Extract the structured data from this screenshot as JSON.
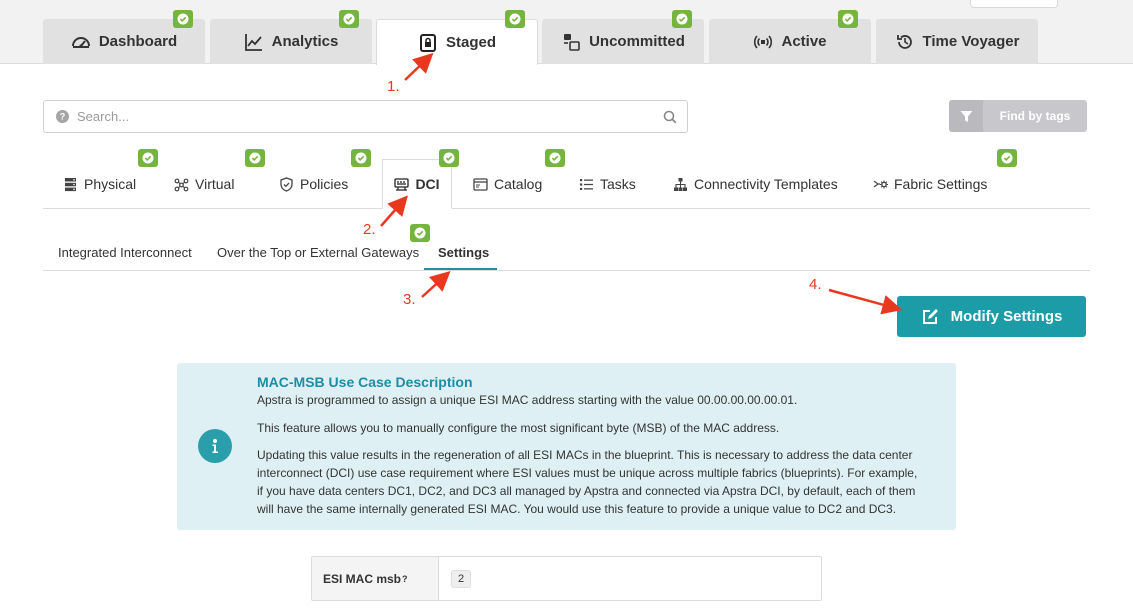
{
  "main_tabs": [
    {
      "label": "Dashboard",
      "icon": "dashboard-gauge-icon"
    },
    {
      "label": "Analytics",
      "icon": "line-chart-icon"
    },
    {
      "label": "Staged",
      "icon": "staged-lock-file-icon",
      "active": true
    },
    {
      "label": "Uncommitted",
      "icon": "uncommitted-icon"
    },
    {
      "label": "Active",
      "icon": "active-signal-icon"
    },
    {
      "label": "Time Voyager",
      "icon": "history-clock-icon"
    }
  ],
  "search": {
    "placeholder": "Search..."
  },
  "find_by_tags": {
    "label": "Find by tags"
  },
  "sub_tabs": [
    {
      "label": "Physical"
    },
    {
      "label": "Virtual"
    },
    {
      "label": "Policies"
    },
    {
      "label": "DCI",
      "active": true
    },
    {
      "label": "Catalog"
    },
    {
      "label": "Tasks"
    },
    {
      "label": "Connectivity Templates"
    },
    {
      "label": "Fabric Settings"
    }
  ],
  "dci_tabs": [
    {
      "label": "Integrated Interconnect"
    },
    {
      "label": "Over the Top or External Gateways"
    },
    {
      "label": "Settings",
      "active": true
    }
  ],
  "modify_button": {
    "label": "Modify Settings"
  },
  "info": {
    "title": "MAC-MSB Use Case Description",
    "p1": "Apstra is programmed to assign a unique ESI MAC address starting with the value 00.00.00.00.00.01.",
    "p2": "This feature allows you to manually configure the most significant byte (MSB) of the MAC address.",
    "p3_l1": "Updating this value results in the regeneration of all ESI MACs in the blueprint. This is necessary to address the data center",
    "p3_l2": "interconnect (DCI) use case requirement where ESI values must be unique across multiple fabrics (blueprints). For example,",
    "p3_l3": "if you have data centers DC1, DC2, and DC3 all managed by Apstra and connected via Apstra DCI, by default, each of them",
    "p3_l4": "will have the same internally generated ESI MAC. You would use this feature to provide a unique value to DC2 and DC3."
  },
  "esi_field": {
    "label": "ESI MAC msb",
    "help": "?",
    "value": "2"
  },
  "annotations": [
    "1.",
    "2.",
    "3.",
    "4."
  ],
  "colors": {
    "accent": "#1b9ca6",
    "check": "#76b53d",
    "annotation": "#e8391e",
    "info_bg": "#def0f3"
  }
}
